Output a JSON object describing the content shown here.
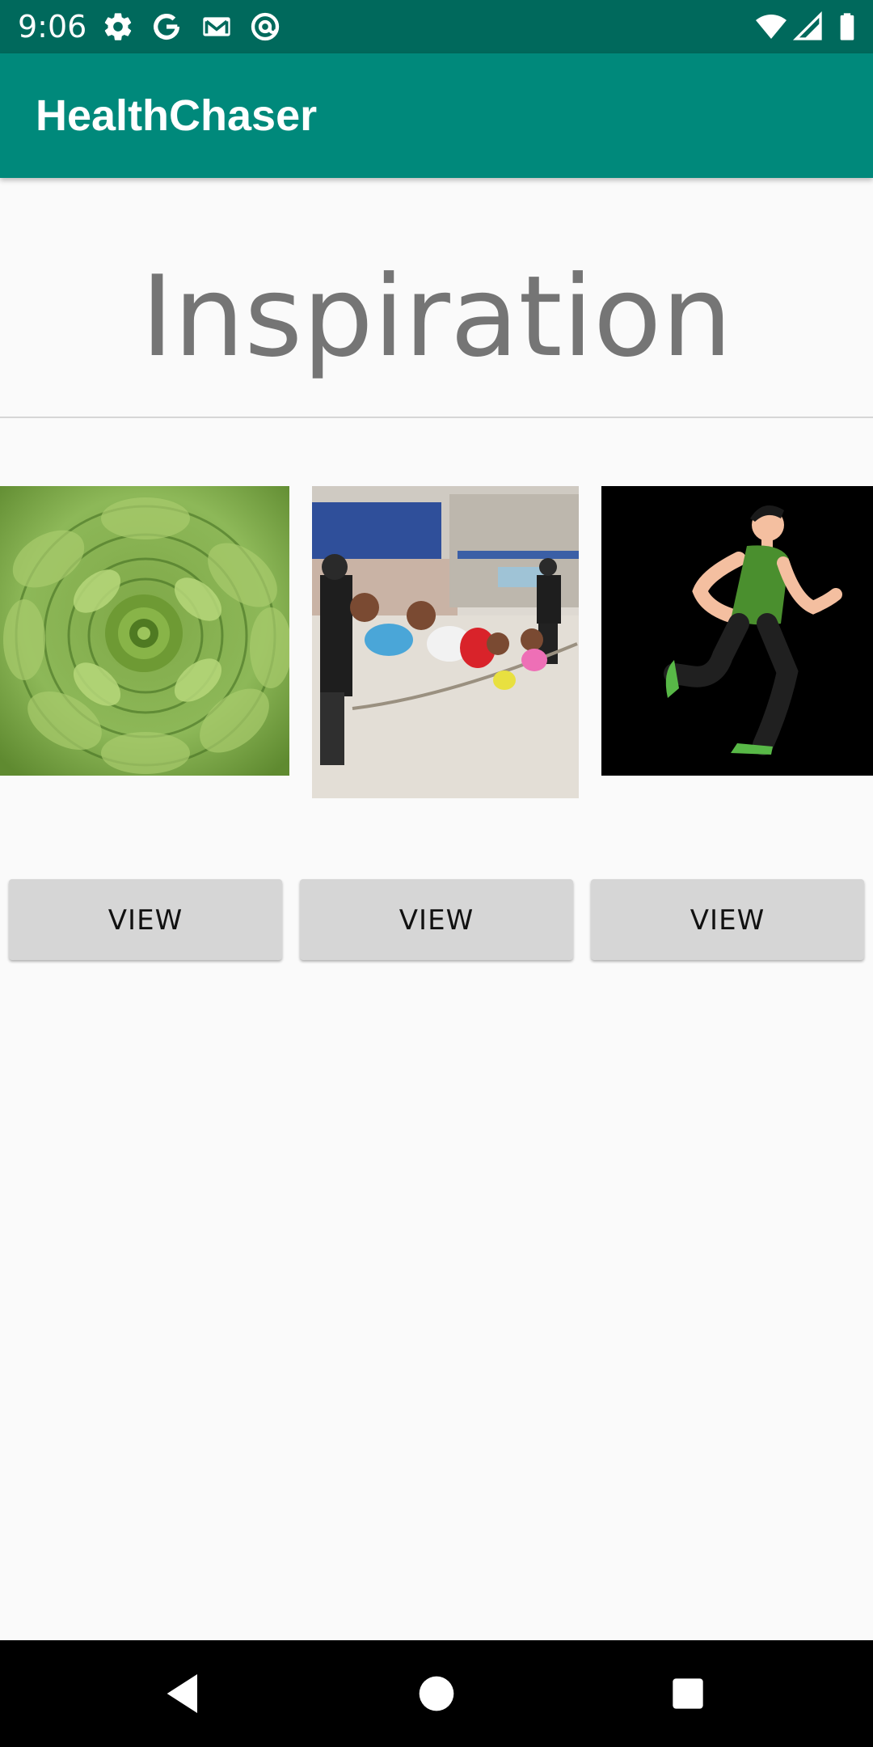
{
  "status_bar": {
    "time": "9:06",
    "left_icons": [
      "gear-icon",
      "google-icon",
      "gmail-icon",
      "at-sign-icon"
    ],
    "right_icons": [
      "wifi-icon",
      "signal-icon",
      "battery-icon"
    ]
  },
  "app_bar": {
    "title": "HealthChaser",
    "color": "#00897b",
    "status_color": "#00695c"
  },
  "page": {
    "heading": "Inspiration"
  },
  "gallery": [
    {
      "image": "artichoke-image",
      "button_label": "VIEW"
    },
    {
      "image": "jumping-dogs-image",
      "button_label": "VIEW"
    },
    {
      "image": "running-man-image",
      "button_label": "VIEW"
    }
  ],
  "nav_bar": {
    "buttons": [
      "back-icon",
      "home-icon",
      "recents-icon"
    ]
  }
}
